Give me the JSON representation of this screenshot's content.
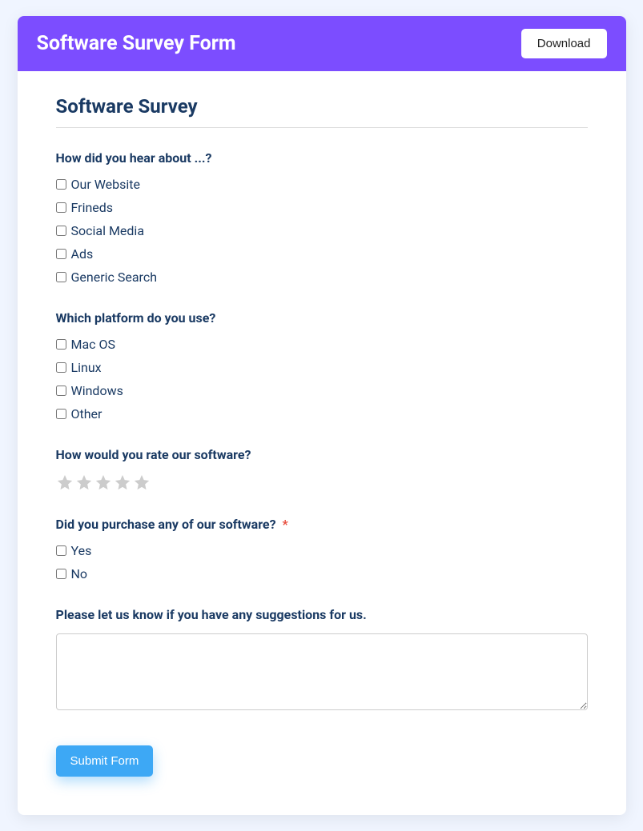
{
  "header": {
    "title": "Software Survey Form",
    "download_label": "Download"
  },
  "form": {
    "title": "Software Survey",
    "q1": {
      "label": "How did you hear about ...?",
      "options": [
        "Our Website",
        "Frineds",
        "Social Media",
        "Ads",
        "Generic Search"
      ]
    },
    "q2": {
      "label": "Which platform do you use?",
      "options": [
        "Mac OS",
        "Linux",
        "Windows",
        "Other"
      ]
    },
    "q3": {
      "label": "How would you rate our software?"
    },
    "q4": {
      "label": "Did you purchase any of our software?",
      "required_mark": "*",
      "options": [
        "Yes",
        "No"
      ]
    },
    "q5": {
      "label": "Please let us know if you have any suggestions for us."
    },
    "submit_label": "Submit Form"
  }
}
